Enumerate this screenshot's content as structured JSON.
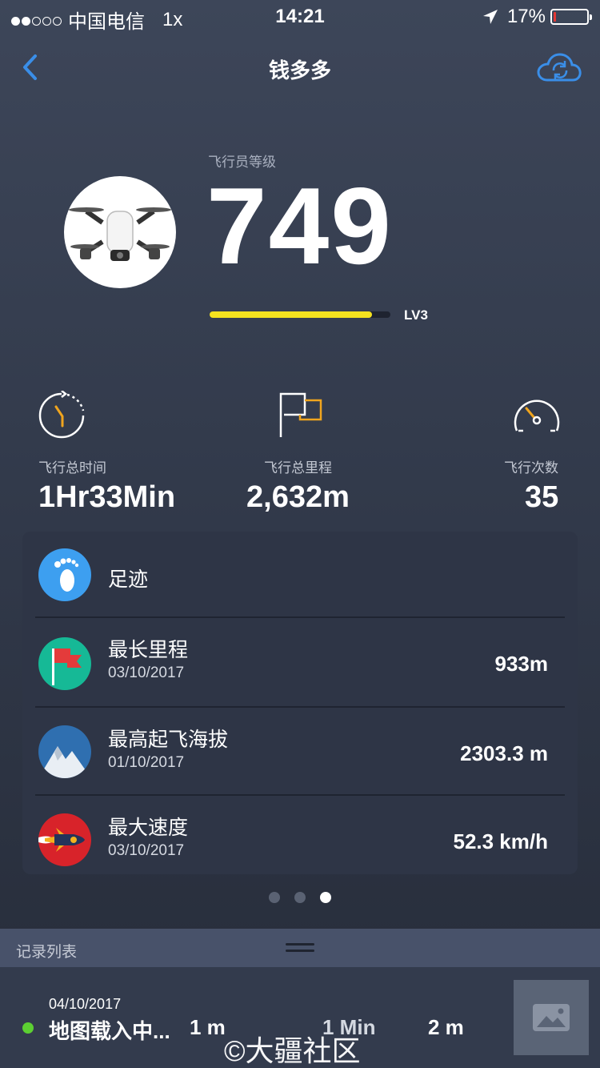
{
  "status_bar": {
    "signal_dots": 5,
    "signal_filled": 2,
    "carrier": "中国电信",
    "network": "1x",
    "time": "14:21",
    "battery_text": "17%",
    "battery_level": 0.17
  },
  "nav": {
    "title": "钱多多"
  },
  "pilot": {
    "level_label": "飞行员等级",
    "level_value": "749",
    "progress_fraction": 0.9,
    "level_tag": "LV3"
  },
  "stats": {
    "time_label": "飞行总时间",
    "time_value": "1Hr33Min",
    "distance_label": "飞行总里程",
    "distance_value": "2,632m",
    "count_label": "飞行次数",
    "count_value": "35"
  },
  "card": {
    "footprint_label": "足迹",
    "records": [
      {
        "title": "最长里程",
        "date": "03/10/2017",
        "value": "933m"
      },
      {
        "title": "最高起飞海拔",
        "date": "01/10/2017",
        "value": "2303.3 m"
      },
      {
        "title": "最大速度",
        "date": "03/10/2017",
        "value": "52.3 km/h"
      }
    ]
  },
  "pager": {
    "pages": 3,
    "active": 2
  },
  "record_list": {
    "title": "记录列表",
    "items": [
      {
        "date": "04/10/2017",
        "name": "地图载入中...",
        "distance": "1 m",
        "duration": "1 Min",
        "height": "2 m"
      }
    ]
  },
  "watermark": "©大疆社区",
  "colors": {
    "accent_blue": "#3a8ee8",
    "xp_yellow": "#f5e21f",
    "icon_orange": "#f0a51e",
    "status_green": "#5ccf32",
    "battery_red": "#e53935"
  }
}
